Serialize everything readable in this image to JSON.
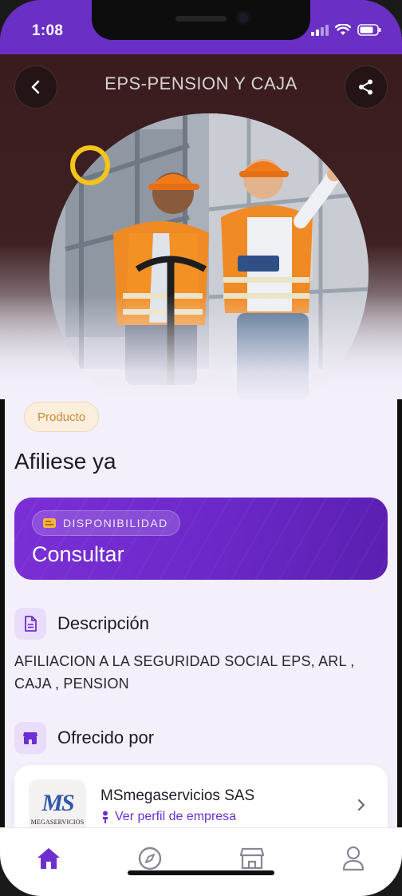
{
  "status_bar": {
    "time": "1:08"
  },
  "header": {
    "title": "EPS-PENSION Y CAJA",
    "back_icon": "chevron-left-icon",
    "share_icon": "share-icon"
  },
  "product": {
    "badge": "Producto",
    "title": "Afiliese ya"
  },
  "availability": {
    "label": "DISPONIBILIDAD",
    "value": "Consultar"
  },
  "description": {
    "heading": "Descripción",
    "text": "AFILIACION A LA SEGURIDAD SOCIAL EPS, ARL , CAJA , PENSION"
  },
  "offered_by": {
    "heading": "Ofrecido por",
    "company_name": "MSmegaservicios SAS",
    "profile_link": "Ver perfil de empresa",
    "logo_mark": "MS",
    "logo_caption": "MEGASERVICIOS"
  },
  "bottom_nav": {
    "items": [
      {
        "name": "home",
        "icon": "home-icon",
        "active": true
      },
      {
        "name": "explore",
        "icon": "compass-icon",
        "active": false
      },
      {
        "name": "store",
        "icon": "store-icon",
        "active": false
      },
      {
        "name": "profile",
        "icon": "user-icon",
        "active": false
      }
    ]
  },
  "colors": {
    "accent": "#6a2fc4",
    "badge_text": "#c98a32",
    "focus_ring": "#f3c51a"
  }
}
